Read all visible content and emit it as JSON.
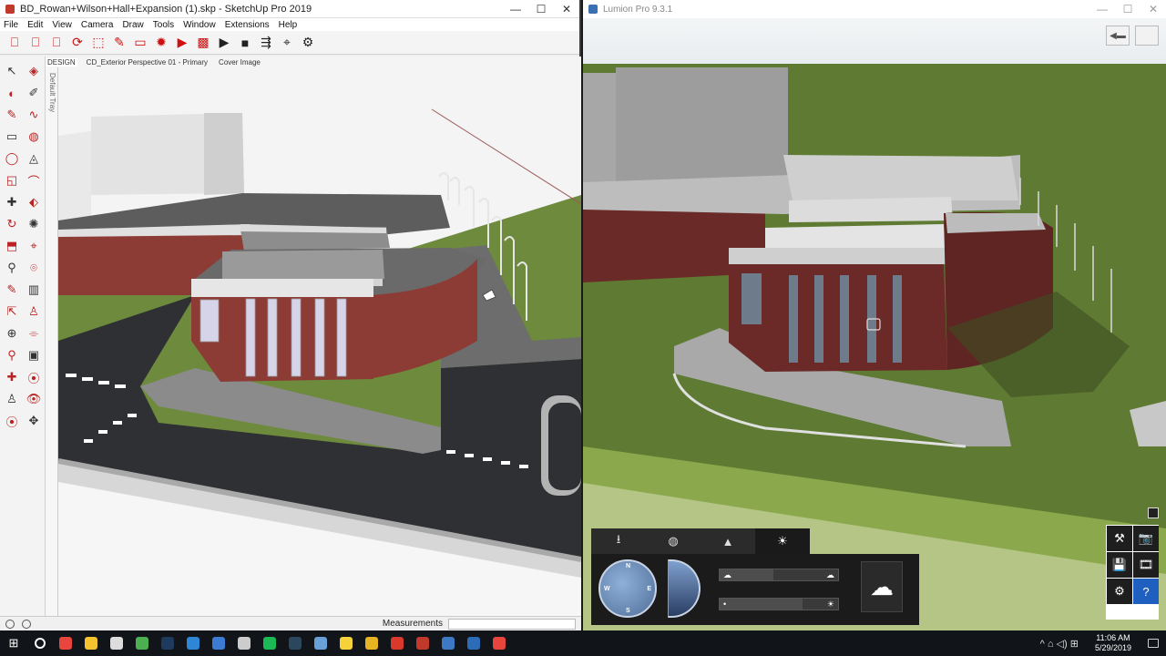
{
  "sketchup": {
    "window_title": "BD_Rowan+Wilson+Hall+Expansion (1).skp - SketchUp Pro 2019",
    "window_controls": [
      "—",
      "☐",
      "✕"
    ],
    "menus": [
      "File",
      "Edit",
      "View",
      "Camera",
      "Draw",
      "Tools",
      "Window",
      "Extensions",
      "Help"
    ],
    "toolbar_icons": [
      "layout-icon",
      "layout-icon-2",
      "section-icon",
      "styles-icon",
      "dashed-select-icon",
      "paint-icon",
      "folder-icon",
      "gear-red-icon",
      "video-icon",
      "ruby-icon",
      "play-icon",
      "stop-icon",
      "export-icon",
      "camera-icon",
      "settings-icon"
    ],
    "toolbar_glyphs": [
      "⎕",
      "⎕",
      "⎕",
      "⟳",
      "⬚",
      "✎",
      "▭",
      "✹",
      "▶",
      "▩",
      "▶",
      "■",
      "⇶",
      "⌖",
      "⚙"
    ],
    "scene_tabs": [
      "DESIGN",
      "CD_Exterior Perspective 01 - Primary",
      "Cover Image"
    ],
    "tray_label": "Default Tray",
    "left_tool_glyphs": [
      "↖",
      "◈",
      "◐",
      "✐",
      "✎",
      "∿",
      "▭",
      "◍",
      "◯",
      "◬",
      "◱",
      "⌒",
      "✚",
      "⬖",
      "↻",
      "✺",
      "⬒",
      "⌖",
      "⚲",
      "⌾",
      "✎",
      "▥",
      "⇱",
      "♙",
      "⊕",
      "⌯",
      "⚲",
      "▣",
      "✚",
      "⦿",
      "♙",
      "👁",
      "⦿",
      "✥"
    ],
    "status_icons": [
      "info-icon",
      "help-icon"
    ],
    "measurements_label": "Measurements",
    "measurements_value": ""
  },
  "lumion": {
    "window_title": "Lumion Pro 9.3.1",
    "window_controls": [
      "—",
      "☐",
      "✕"
    ],
    "top_buttons": [
      "◀▬",
      ""
    ],
    "panel_tabs": [
      {
        "icon": "import-icon",
        "glyph": "⭳"
      },
      {
        "icon": "material-icon",
        "glyph": "◍"
      },
      {
        "icon": "landscape-icon",
        "glyph": "▲"
      },
      {
        "icon": "weather-icon",
        "glyph": "☀"
      }
    ],
    "active_tab": 3,
    "compass_labels": {
      "n": "N",
      "e": "E",
      "s": "S",
      "w": "W"
    },
    "sliders": [
      {
        "name": "cloud-amount-slider",
        "left": "☁",
        "right": "☁",
        "value": 0.45
      },
      {
        "name": "sun-brightness-slider",
        "left": "•",
        "right": "☀",
        "value": 0.7
      }
    ],
    "side_tools": [
      "⚒",
      "📷",
      "💾",
      "🎞",
      "⚙",
      "?"
    ],
    "side_tool_names": [
      "build-mode-icon",
      "photo-mode-icon",
      "save-icon",
      "movie-mode-icon",
      "settings-icon",
      "help-icon"
    ]
  },
  "taskbar": {
    "apps": [
      {
        "name": "chrome-icon",
        "color": "#e8453c"
      },
      {
        "name": "file-explorer-icon",
        "color": "#f4c32f"
      },
      {
        "name": "unity-icon",
        "color": "#dddddd"
      },
      {
        "name": "camtasia-icon",
        "color": "#4caf50"
      },
      {
        "name": "photoshop-icon",
        "color": "#1e3a5f"
      },
      {
        "name": "edge-icon",
        "color": "#2f86d6"
      },
      {
        "name": "mail-icon",
        "color": "#3b7bd4"
      },
      {
        "name": "calculator-icon",
        "color": "#cccccc"
      },
      {
        "name": "spotify-icon",
        "color": "#1db954"
      },
      {
        "name": "steam-icon",
        "color": "#2a475e"
      },
      {
        "name": "cloud-app-icon",
        "color": "#6aa0d8"
      },
      {
        "name": "sticky-notes-icon",
        "color": "#f5d23a"
      },
      {
        "name": "folders-icon",
        "color": "#e6b422"
      },
      {
        "name": "sketchup-icon",
        "color": "#d8392b"
      },
      {
        "name": "layout-app-icon",
        "color": "#c0392b"
      },
      {
        "name": "remote-icon",
        "color": "#3c78c3"
      },
      {
        "name": "lumion-icon",
        "color": "#2c6bb5"
      },
      {
        "name": "chrome-2-icon",
        "color": "#e8453c"
      }
    ],
    "tray_text": "^ ⌂ ◁) ⊞",
    "time": "11:06 AM",
    "date": "5/29/2019"
  }
}
